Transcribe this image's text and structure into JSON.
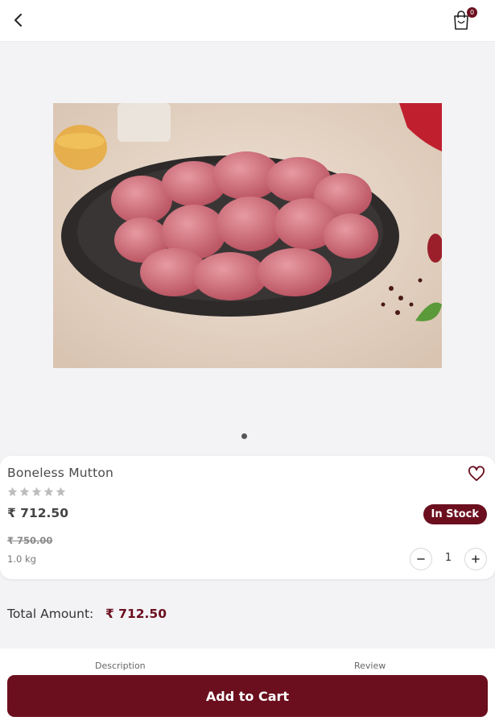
{
  "header": {
    "back_icon": "chevron-left-icon",
    "cart_icon": "shopping-bag-icon",
    "cart_count": "0"
  },
  "gallery": {
    "image_alt": "Boneless Mutton pieces on a black plate",
    "image_count": 1,
    "active_index": 0
  },
  "product": {
    "name": "Boneless Mutton",
    "rating": 0,
    "rating_max": 5,
    "price": "₹ 712.50",
    "original_price": "₹ 750.00",
    "weight": "1.0 kg",
    "stock_status": "In Stock",
    "quantity": "1"
  },
  "total": {
    "label": "Total Amount:",
    "value": "₹ 712.50"
  },
  "tabs": [
    {
      "label": "Description"
    },
    {
      "label": "Review"
    }
  ],
  "cta": {
    "add_to_cart_label": "Add to Cart"
  },
  "colors": {
    "brand": "#6b0f1e",
    "background": "#f3f3f5",
    "card": "#ffffff",
    "star_empty": "#bdbdbd"
  }
}
